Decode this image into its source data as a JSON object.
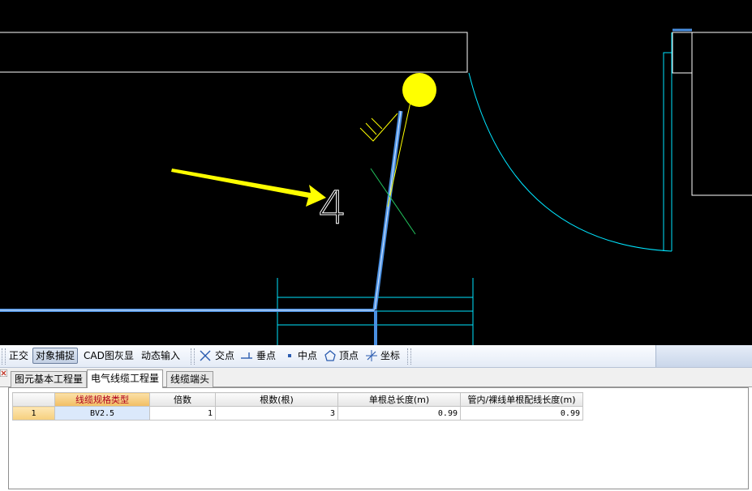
{
  "canvas": {
    "background": "#000000",
    "annotation_number": "4",
    "colors": {
      "wire": "#4a90e2",
      "cyan": "#00e5ff",
      "yellow": "#ffff00",
      "green": "#22c55e",
      "white": "#ffffff"
    }
  },
  "toolbar": {
    "orthogonal_label": "正交",
    "object_snap_label": "对象捕捉",
    "cad_gray_label": "CAD图灰显",
    "dynamic_input_label": "动态输入",
    "intersection_label": "交点",
    "perpendicular_label": "垂点",
    "midpoint_label": "中点",
    "vertex_label": "顶点",
    "coordinate_label": "坐标"
  },
  "tabs": [
    {
      "label": "图元基本工程量",
      "active": false
    },
    {
      "label": "电气线缆工程量",
      "active": true
    },
    {
      "label": "线缆端头",
      "active": false
    }
  ],
  "table": {
    "headers": [
      "",
      "线缆规格类型",
      "倍数",
      "根数(根)",
      "单根总长度(m)",
      "管内/裸线单根配线长度(m)"
    ],
    "rows": [
      {
        "index": "1",
        "type": "BV2.5",
        "multiple": "1",
        "count": "3",
        "total_length": "0.99",
        "pipe_length": "0.99"
      }
    ]
  }
}
